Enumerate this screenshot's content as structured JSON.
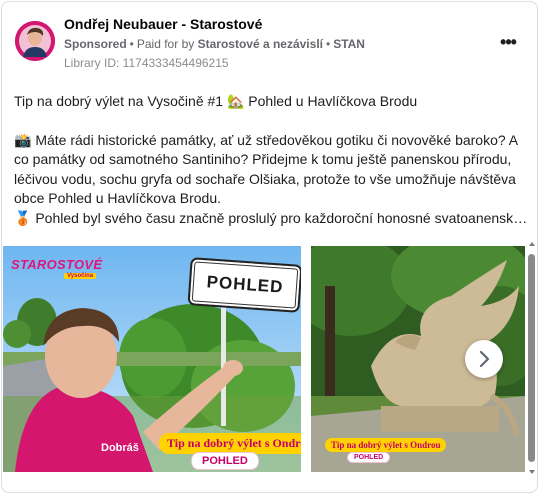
{
  "post": {
    "author": "Ondřej Neubauer - Starostové",
    "sponsored": "Sponsored",
    "paid_for_prefix": "Paid for by",
    "paid_for_name": "Starostové a nezávislí",
    "paid_for_party": "STAN",
    "library_id": "Library ID: 1174333454496215",
    "text_line1": "Tip na dobrý výlet na Vysočině #1 🏡 Pohled u Havlíčkova Brodu",
    "text_paragraph": "📸 Máte rádi historické památky, ať už středověkou gotiku či novověké baroko? A co památky od samotného Santiniho? Přidejme k tomu ještě panenskou přírodu, léčivou vodu, sochu gryfa od sochaře Olšiaka, protože to vše umožňuje návštěva obce Pohled u Havlíčkova Brodu.",
    "text_line_last": "🥉 Pohled byl svého času značně proslulý pro každoroční honosné svatoanenské…"
  },
  "slide1": {
    "brand": "STAROSTOVÉ",
    "brand_sub": "Vysočina",
    "sign": "POHLED",
    "shirt_text": "Dobráš",
    "tag": "Tip na dobrý výlet s Ondrou",
    "pill": "POHLED"
  },
  "slide2": {
    "tag": "Tip na dobrý výlet s Ondrou",
    "pill": "POHLED"
  },
  "icons": {
    "more": "more-options-icon",
    "next": "chevron-right-icon"
  },
  "colors": {
    "brand": "#e2147b",
    "tag_bg": "#ffd200",
    "text_secondary": "#65676b"
  }
}
